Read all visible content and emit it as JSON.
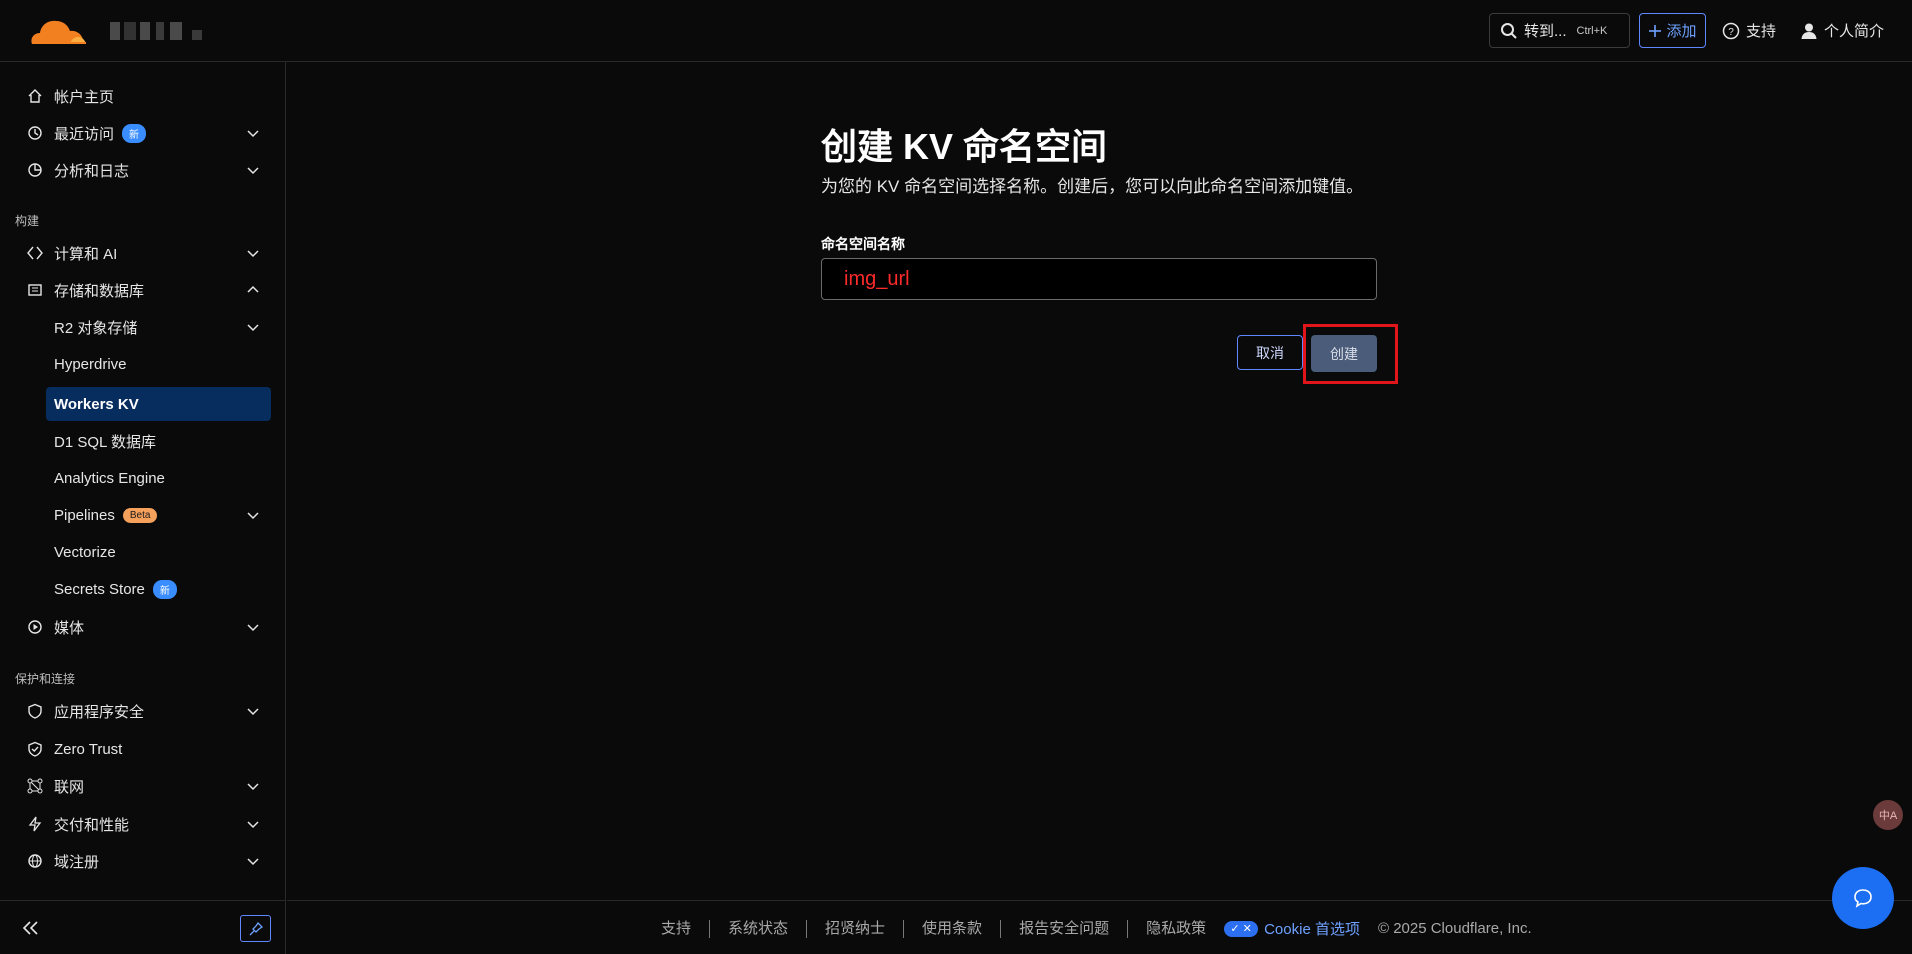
{
  "topbar": {
    "search_label": "转到...",
    "search_shortcut": "Ctrl+K",
    "add_label": "添加",
    "support_label": "支持",
    "profile_label": "个人简介"
  },
  "sidebar": {
    "home": "帐户主页",
    "recent": "最近访问",
    "recent_badge": "新",
    "analytics": "分析和日志",
    "section_build": "构建",
    "compute_ai": "计算和 AI",
    "storage_db": "存储和数据库",
    "r2": "R2 对象存储",
    "hyperdrive": "Hyperdrive",
    "workers_kv": "Workers KV",
    "d1": "D1 SQL 数据库",
    "analytics_engine": "Analytics Engine",
    "pipelines": "Pipelines",
    "pipelines_badge": "Beta",
    "vectorize": "Vectorize",
    "secrets_store": "Secrets Store",
    "secrets_badge": "新",
    "media": "媒体",
    "section_protect": "保护和连接",
    "app_security": "应用程序安全",
    "zero_trust": "Zero Trust",
    "networking": "联网",
    "delivery": "交付和性能",
    "domain_reg": "域注册"
  },
  "main": {
    "title": "创建 KV 命名空间",
    "subtitle": "为您的 KV 命名空间选择名称。创建后，您可以向此命名空间添加键值。",
    "field_label": "命名空间名称",
    "field_value": "img_url",
    "cancel_label": "取消",
    "create_label": "创建"
  },
  "footer": {
    "links": [
      "支持",
      "系统状态",
      "招贤纳士",
      "使用条款",
      "报告安全问题",
      "隐私政策"
    ],
    "cookie_label": "Cookie 首选项",
    "copyright": "© 2025 Cloudflare, Inc."
  },
  "colors": {
    "accent": "#5f87ff",
    "active_bg": "#072c5e",
    "brand_orange": "#f38020",
    "highlight": "#e2151b"
  },
  "floating": {
    "translate_label": "中A"
  }
}
